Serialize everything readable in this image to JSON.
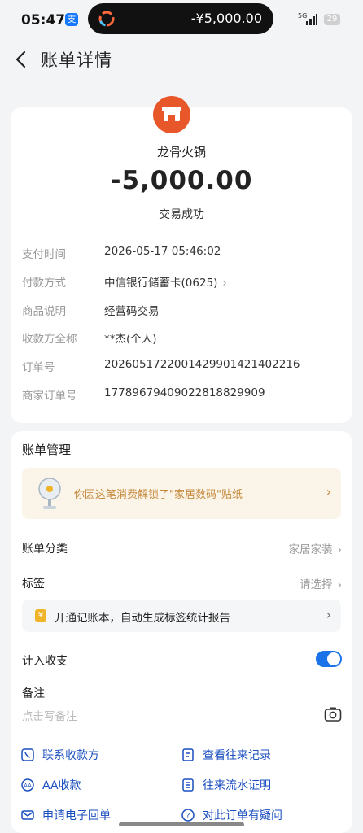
{
  "status_bar": {
    "time": "05:47",
    "app_icon": "支",
    "island_amount": "-¥5,000.00",
    "network": "5G",
    "battery": "29"
  },
  "header": {
    "title": "账单详情"
  },
  "transaction": {
    "merchant": "龙骨火锅",
    "amount": "-5,000.00",
    "status": "交易成功"
  },
  "details": [
    {
      "label": "支付时间",
      "value": "2026-05-17 05:46:02"
    },
    {
      "label": "付款方式",
      "value": "中信银行储蓄卡(0625)"
    },
    {
      "label": "商品说明",
      "value": "经营码交易"
    },
    {
      "label": "收款方全称",
      "value": "**杰(个人)"
    },
    {
      "label": "订单号",
      "value": "2026051722001429901421402216"
    },
    {
      "label": "商家订单号",
      "value": "1778967940902281882990 9"
    }
  ],
  "management": {
    "title": "账单管理",
    "banner_text": "你因这笔消费解锁了\"家居数码\"贴纸",
    "category_label": "账单分类",
    "category_value": "家居家装",
    "tag_label": "标签",
    "tag_value": "请选择",
    "report_icon": "¥",
    "report_text": "开通记账本，自动生成标签统计报告",
    "include_label": "计入收支",
    "include_on": true,
    "note_label": "备注",
    "note_placeholder": "点击写备注"
  },
  "actions": [
    {
      "label": "联系收款方",
      "icon": "contact-icon"
    },
    {
      "label": "查看往来记录",
      "icon": "records-icon"
    },
    {
      "label": "AA收款",
      "icon": "aa-icon"
    },
    {
      "label": "往来流水证明",
      "icon": "statement-icon"
    },
    {
      "label": "申请电子回单",
      "icon": "mail-icon"
    },
    {
      "label": "对此订单有疑问",
      "icon": "question-icon"
    }
  ],
  "colors": {
    "accent": "#1a73e8",
    "merchant_logo": "#e8572a",
    "banner_bg": "#fbf4e8",
    "banner_text": "#c58a3d"
  }
}
